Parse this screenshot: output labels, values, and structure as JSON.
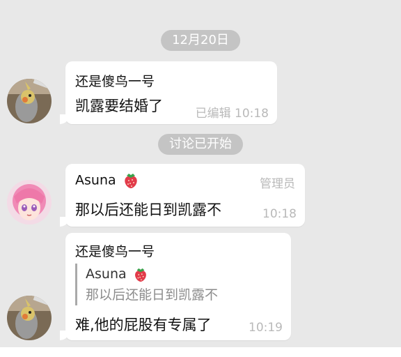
{
  "date_pill": "12月20日",
  "system_pill": "讨论已开始",
  "messages": [
    {
      "sender": "还是傻鸟一号",
      "text": "凯露要结婚了",
      "edited": "已编辑",
      "time": "10:18",
      "avatar": "cockatiel-bird-avatar"
    },
    {
      "sender": "Asuna",
      "sender_emoji": "strawberry-icon",
      "role": "管理员",
      "text": "那以后还能日到凯露不",
      "time": "10:18",
      "avatar": "anime-girl-pink-hair-avatar"
    },
    {
      "sender": "还是傻鸟一号",
      "reply_to": {
        "sender": "Asuna",
        "text": "那以后还能日到凯露不"
      },
      "text": "难,他的屁股有专属了",
      "time": "10:19",
      "avatar": "cockatiel-bird-avatar"
    }
  ],
  "colors": {
    "background": "#e8e8e8",
    "bubble": "#ffffff",
    "pill": "#c4c4c4",
    "meta_text": "#b9b9b9"
  }
}
